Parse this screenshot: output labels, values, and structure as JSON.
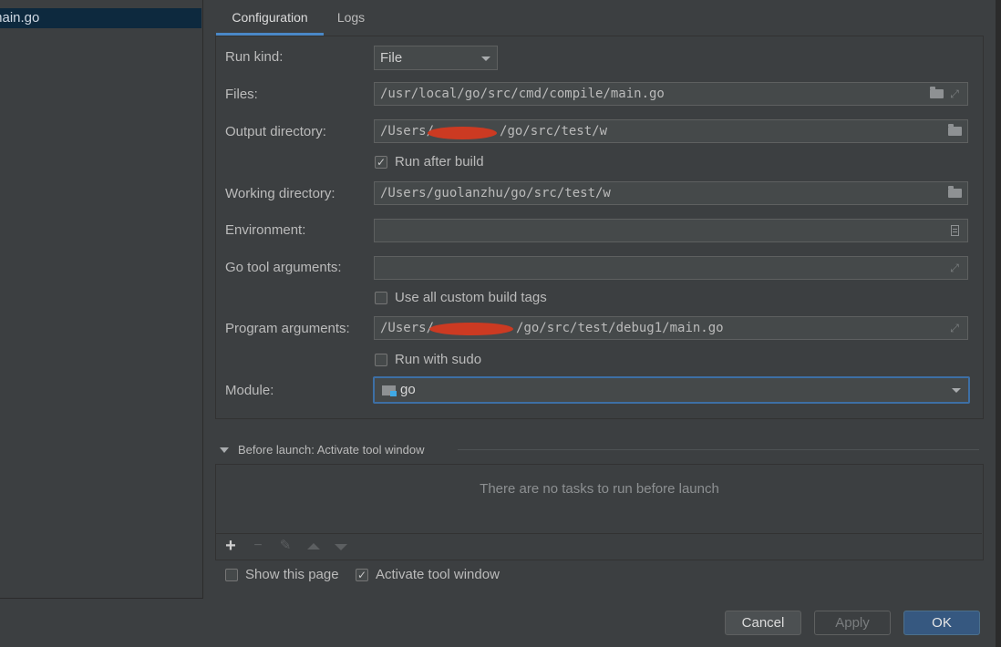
{
  "tree": {
    "selected_item": "main.go"
  },
  "tabs": [
    {
      "label": "Configuration"
    },
    {
      "label": "Logs"
    }
  ],
  "form": {
    "run_kind": {
      "label": "Run kind:",
      "value": "File"
    },
    "files": {
      "label": "Files:",
      "value": "/usr/local/go/src/cmd/compile/main.go"
    },
    "output_directory": {
      "label": "Output directory:",
      "value_prefix": "/Users/",
      "value_suffix": "/go/src/test/w"
    },
    "run_after_build": {
      "label": "Run after build",
      "checked": true
    },
    "working_directory": {
      "label": "Working directory:",
      "value": "/Users/guolanzhu/go/src/test/w"
    },
    "environment": {
      "label": "Environment:",
      "value": ""
    },
    "go_tool_arguments": {
      "label": "Go tool arguments:",
      "value": ""
    },
    "use_all_custom_build_tags": {
      "label": "Use all custom build tags",
      "checked": false
    },
    "program_arguments": {
      "label": "Program arguments:",
      "value_prefix": "/Users/",
      "value_suffix": "/go/src/test/debug1/main.go"
    },
    "run_with_sudo": {
      "label": "Run with sudo",
      "checked": false
    },
    "module": {
      "label": "Module:",
      "value": "go"
    }
  },
  "before_launch": {
    "title": "Before launch: Activate tool window",
    "empty_message": "There are no tasks to run before launch",
    "toolbar": {
      "add": "+",
      "remove": "−"
    }
  },
  "options": {
    "show_this_page": {
      "label": "Show this page",
      "checked": false
    },
    "activate_tool_window": {
      "label": "Activate tool window",
      "checked": true
    }
  },
  "buttons": {
    "cancel": "Cancel",
    "apply": "Apply",
    "ok": "OK"
  },
  "colors": {
    "background": "#3c3f41",
    "accent": "#4a88c7",
    "ok_button": "#365880",
    "redaction": "#cc3a22"
  }
}
